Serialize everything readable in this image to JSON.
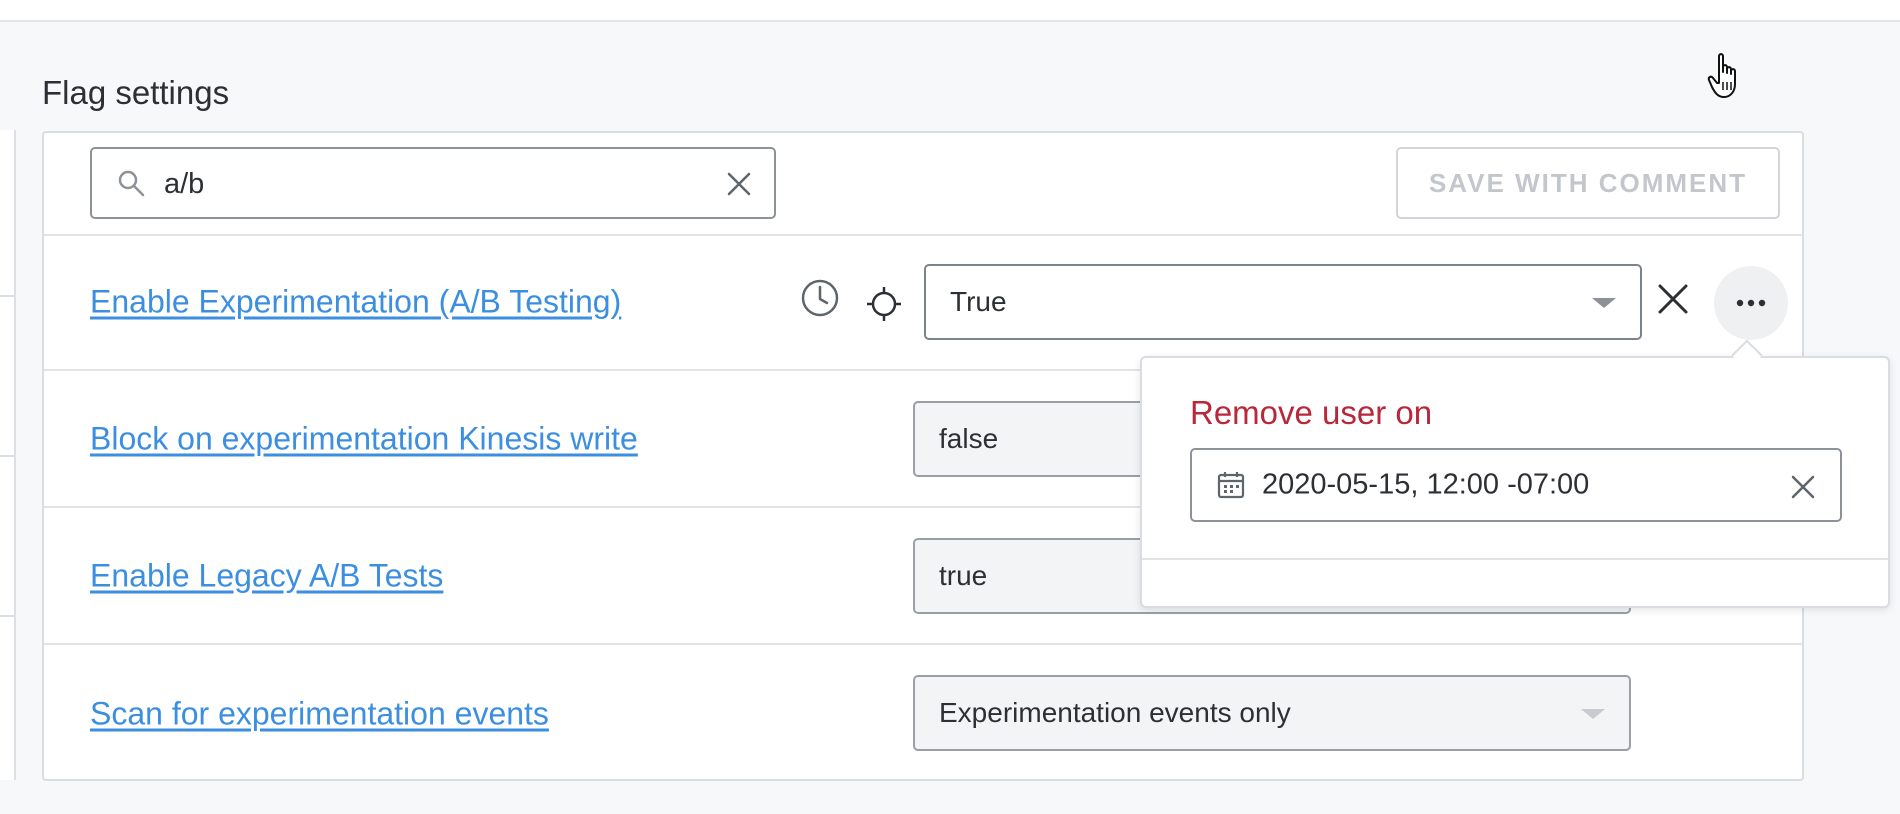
{
  "section": {
    "title": "Flag settings"
  },
  "toolbar": {
    "search_value": "a/b",
    "save_label": "SAVE WITH COMMENT"
  },
  "flags": [
    {
      "name": "Enable Experimentation (A/B Testing)",
      "value": "True"
    },
    {
      "name": "Block on experimentation Kinesis write",
      "value": "false"
    },
    {
      "name": "Enable Legacy A/B Tests",
      "value": "true"
    },
    {
      "name": "Scan for experimentation events",
      "value": "Experimentation events only"
    }
  ],
  "popover": {
    "title": "Remove user on",
    "date_value": "2020-05-15, 12:00 -07:00"
  },
  "colors": {
    "link": "#3c8fe0",
    "danger": "#b8283a",
    "disabled_text": "#c3c7cc"
  },
  "icons": {
    "search": "search-icon",
    "clear": "close-icon",
    "clock": "clock-icon",
    "target": "target-icon",
    "more": "more-horizontal-icon",
    "calendar": "calendar-icon"
  }
}
